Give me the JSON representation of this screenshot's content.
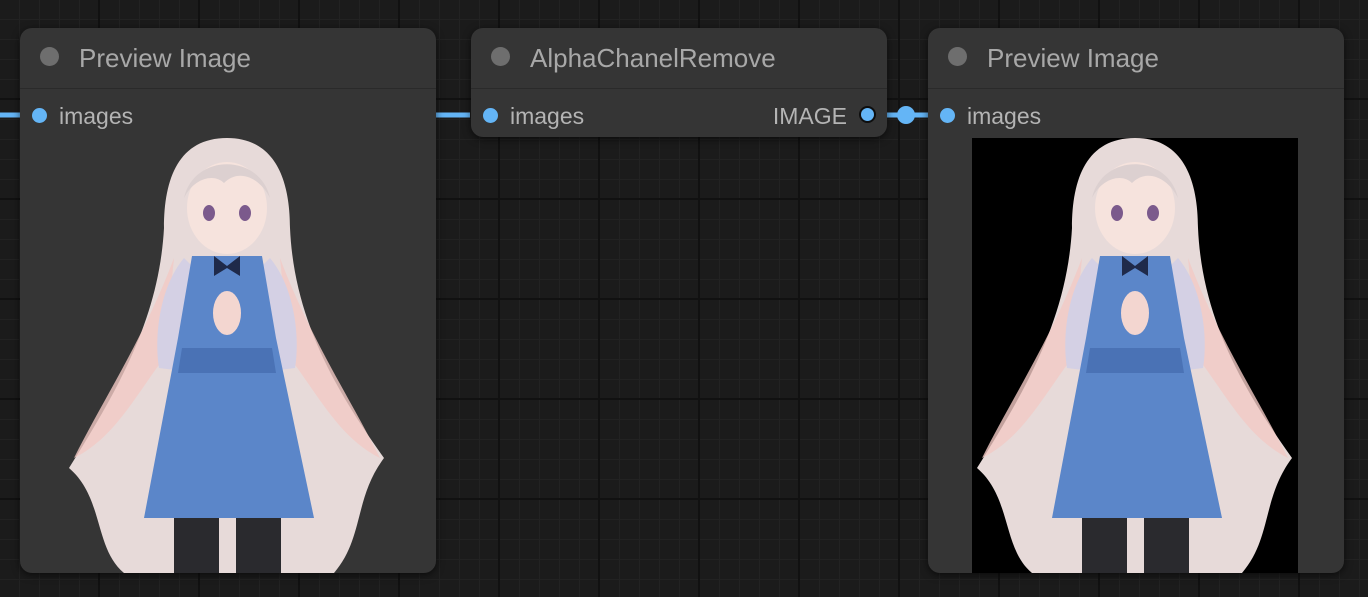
{
  "nodes": {
    "preview_left": {
      "title": "Preview Image",
      "input_label": "images"
    },
    "alpha_remove": {
      "title": "AlphaChanelRemove",
      "input_label": "images",
      "output_label": "IMAGE"
    },
    "preview_right": {
      "title": "Preview Image",
      "input_label": "images"
    }
  },
  "images": {
    "left_background": "transparent",
    "right_background": "#000000",
    "subject": "anime-girl-illustration"
  },
  "colors": {
    "canvas": "#1b1b1b",
    "node_body": "#353535",
    "link": "#64b5f6",
    "slot": "#64b5f6",
    "title_dot": "#6e6e6e"
  }
}
